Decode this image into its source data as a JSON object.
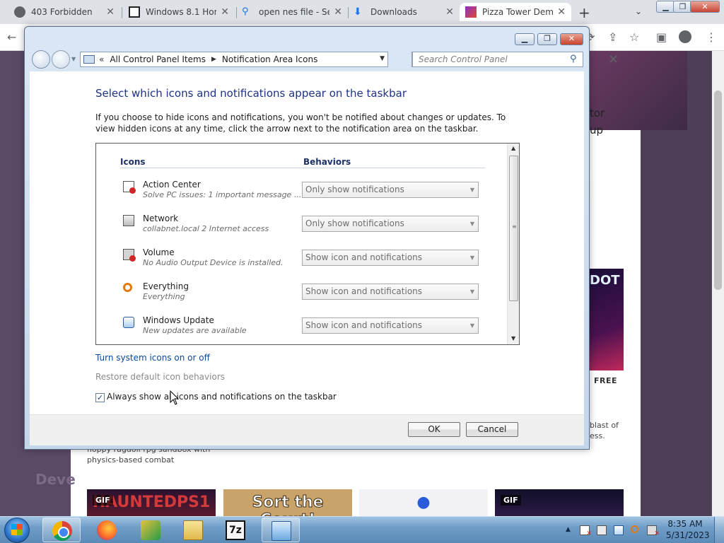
{
  "browser": {
    "tabs": [
      {
        "title": "403 Forbidden",
        "icon": "globe-icon"
      },
      {
        "title": "Windows 8.1 Hom",
        "icon": "page-icon"
      },
      {
        "title": "open nes file - Se",
        "icon": "search-icon"
      },
      {
        "title": "Downloads",
        "icon": "download-icon"
      },
      {
        "title": "Pizza Tower Demo",
        "icon": "game-icon"
      }
    ],
    "page": {
      "text_fragment_1": "tor",
      "text_fragment_2": "up",
      "game_title_fragment": "DOT",
      "free_badge": "FREE",
      "right_desc_1": "blast of",
      "right_desc_2": "ess.",
      "left_desc_1": "floppy ragdoll rpg sandbox with",
      "left_desc_2": "physics-based combat",
      "dev_label": "Deve",
      "tiles": [
        {
          "badge": "GIF",
          "title": "HAUNTEDPS1"
        },
        {
          "badge": "",
          "title": "Sort the Court!"
        },
        {
          "badge": "",
          "title": ""
        },
        {
          "badge": "GIF",
          "title": ""
        }
      ]
    }
  },
  "control_panel": {
    "breadcrumb": [
      "All Control Panel Items",
      "Notification Area Icons"
    ],
    "search_placeholder": "Search Control Panel",
    "heading": "Select which icons and notifications appear on the taskbar",
    "description": "If you choose to hide icons and notifications, you won't be notified about changes or updates. To view hidden icons at any time, click the arrow next to the notification area on the taskbar.",
    "columns": {
      "icons": "Icons",
      "behaviors": "Behaviors"
    },
    "items": [
      {
        "name": "Action Center",
        "subtitle": "Solve PC issues: 1 important message ...",
        "behavior": "Only show notifications",
        "icon": "action-center-icon"
      },
      {
        "name": "Network",
        "subtitle": "collabnet.local  2 Internet access",
        "behavior": "Only show notifications",
        "icon": "network-icon"
      },
      {
        "name": "Volume",
        "subtitle": "No Audio Output Device is installed.",
        "behavior": "Show icon and notifications",
        "icon": "volume-icon"
      },
      {
        "name": "Everything",
        "subtitle": "Everything",
        "behavior": "Show icon and notifications",
        "icon": "everything-search-icon"
      },
      {
        "name": "Windows Update",
        "subtitle": "New updates are available",
        "behavior": "Show icon and notifications",
        "icon": "windows-update-icon"
      }
    ],
    "link_system_icons": "Turn system icons on or off",
    "link_restore": "Restore default icon behaviors",
    "always_show_label": "Always show all icons and notifications on the taskbar",
    "always_show_checked": true,
    "ok_label": "OK",
    "cancel_label": "Cancel"
  },
  "taskbar": {
    "apps": [
      "Google Chrome",
      "Firefox",
      "App",
      "Windows Explorer",
      "7-Zip",
      "Control Panel"
    ],
    "tile_7zip_text": "7z",
    "clock_time": "8:35 AM",
    "clock_date": "5/31/2023"
  }
}
